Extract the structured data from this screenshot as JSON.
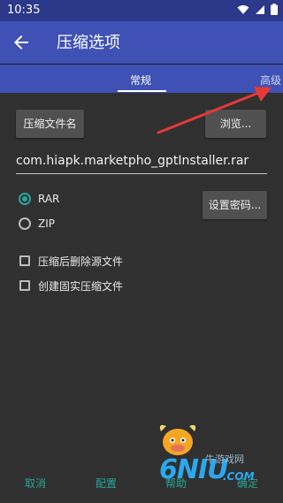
{
  "status_bar": {
    "time": "10:35",
    "icons": [
      "wifi-icon",
      "signal-icon",
      "battery-icon"
    ]
  },
  "app_bar": {
    "title": "压缩选项",
    "back_icon": "arrow-back-icon"
  },
  "tabs": [
    {
      "label": "常规",
      "selected": true
    },
    {
      "label": "高级",
      "selected": false
    }
  ],
  "general": {
    "archive_name_button": "压缩文件名",
    "browse_button": "浏览...",
    "filename_value": "com.hiapk.marketpho_gptInstaller.rar",
    "formats": [
      {
        "label": "RAR",
        "checked": true
      },
      {
        "label": "ZIP",
        "checked": false
      }
    ],
    "set_password_button": "设置密码...",
    "options": [
      {
        "label": "压缩后删除源文件",
        "checked": false
      },
      {
        "label": "创建固实压缩文件",
        "checked": false
      }
    ]
  },
  "footer": {
    "cancel": "取消",
    "config": "配置",
    "help": "帮助",
    "ok": "确定"
  },
  "watermark": {
    "brand": "6NIU",
    "suffix": ".COM",
    "cn": "牛游戏网"
  },
  "colors": {
    "status_bar": "#2c3889",
    "app_bar": "#3f51b5",
    "accent": "#26a69a",
    "background": "#303030",
    "arrow": "#e53935"
  }
}
